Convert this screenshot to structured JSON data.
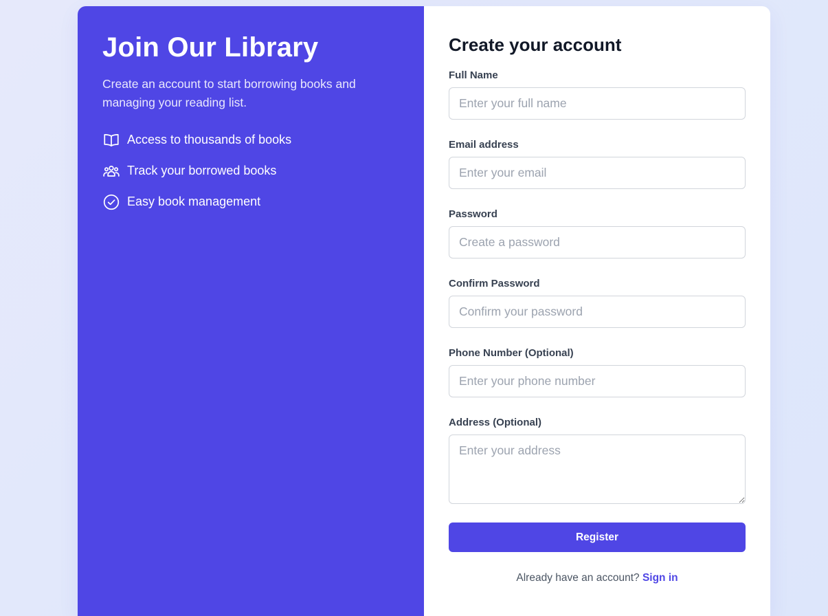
{
  "promo": {
    "title": "Join Our Library",
    "subtitle": "Create an account to start borrowing books and managing your reading list.",
    "features": [
      {
        "icon": "book-open-icon",
        "label": "Access to thousands of books"
      },
      {
        "icon": "users-icon",
        "label": "Track your borrowed books"
      },
      {
        "icon": "check-circle-icon",
        "label": "Easy book management"
      }
    ]
  },
  "form": {
    "title": "Create your account",
    "fields": {
      "full_name": {
        "label": "Full Name",
        "placeholder": "Enter your full name",
        "value": ""
      },
      "email": {
        "label": "Email address",
        "placeholder": "Enter your email",
        "value": ""
      },
      "password": {
        "label": "Password",
        "placeholder": "Create a password",
        "value": ""
      },
      "confirm_password": {
        "label": "Confirm Password",
        "placeholder": "Confirm your password",
        "value": ""
      },
      "phone": {
        "label": "Phone Number (Optional)",
        "placeholder": "Enter your phone number",
        "value": ""
      },
      "address": {
        "label": "Address (Optional)",
        "placeholder": "Enter your address",
        "value": ""
      }
    },
    "register_label": "Register",
    "signin_prompt": "Already have an account?",
    "signin_link": "Sign in"
  },
  "colors": {
    "accent": "#4f46e5",
    "background": "#e3e9fb",
    "card": "#ffffff"
  }
}
